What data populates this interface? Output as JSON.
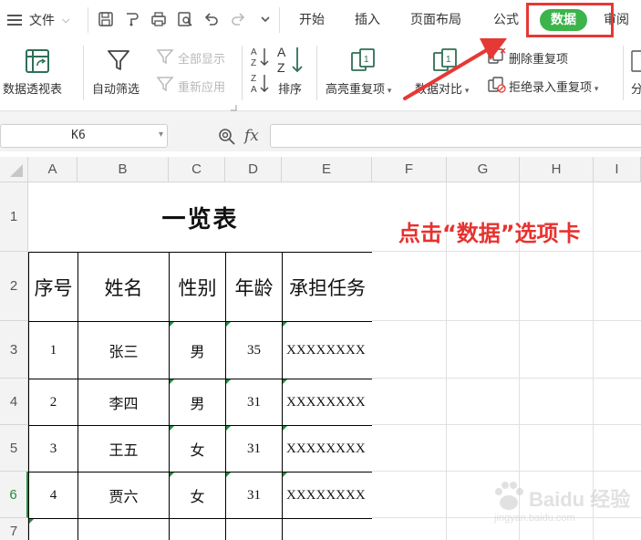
{
  "menu": {
    "file_label": "文件",
    "tabs": [
      "开始",
      "插入",
      "页面布局",
      "公式",
      "审阅"
    ],
    "active_tab": "数据"
  },
  "ribbon": {
    "pivot_label": "数据透视表",
    "autofilter_label": "自动筛选",
    "show_all_label": "全部显示",
    "reapply_label": "重新应用",
    "sort_label": "排序",
    "highlight_dup_label": "高亮重复项",
    "data_compare_label": "数据对比",
    "remove_dup_label": "删除重复项",
    "reject_dup_label": "拒绝录入重复项",
    "split_label": "分"
  },
  "formula_bar": {
    "name_box": "K6",
    "fx": "fx",
    "formula": ""
  },
  "sheet": {
    "columns": [
      "A",
      "B",
      "C",
      "D",
      "E",
      "F",
      "G",
      "H",
      "I"
    ],
    "rows": [
      "1",
      "2",
      "3",
      "4",
      "5",
      "6",
      "7"
    ],
    "active_row": "6",
    "title": "一览表",
    "headers": [
      "序号",
      "姓名",
      "性别",
      "年龄",
      "承担任务"
    ],
    "data": [
      [
        "1",
        "张三",
        "男",
        "35",
        "XXXXXXXX"
      ],
      [
        "2",
        "李四",
        "男",
        "31",
        "XXXXXXXX"
      ],
      [
        "3",
        "王五",
        "女",
        "31",
        "XXXXXXXX"
      ],
      [
        "4",
        "贾六",
        "女",
        "31",
        "XXXXXXXX"
      ]
    ]
  },
  "annotation": "点击“数据”选项卡",
  "watermark": {
    "brand": "Baidu 经验",
    "url": "jingyan.baidu.com"
  },
  "colors": {
    "accent_green": "#3cb44b",
    "annotation_red": "#e8322f"
  }
}
